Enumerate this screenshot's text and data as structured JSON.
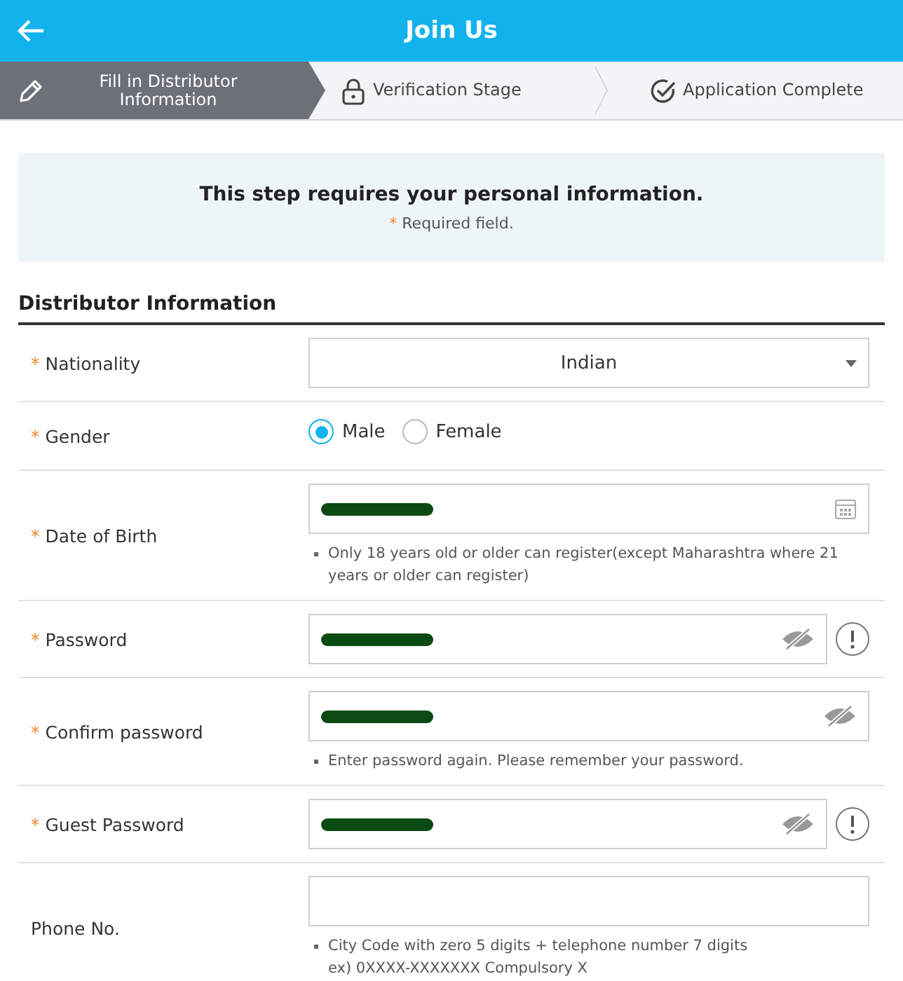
{
  "header": {
    "back_button": true,
    "title": "Join Us"
  },
  "steps": [
    {
      "label": "Fill in Distributor\nInformation",
      "selected": true
    },
    {
      "label": "Verification Stage",
      "selected": false
    },
    {
      "label": "Application Complete",
      "selected": false
    }
  ],
  "notice": {
    "title": "This step requires your personal information.",
    "required_mark": "*",
    "required_note": "Required field."
  },
  "section_title": "Distributor Information",
  "fields": [
    {
      "kind": "select",
      "required_mark": "*",
      "label": "Nationality",
      "value": "Indian"
    },
    {
      "kind": "radio",
      "required_mark": "*",
      "label": "Gender",
      "options": [
        {
          "label": "Male",
          "selected": true
        },
        {
          "label": "Female",
          "selected": false
        }
      ]
    },
    {
      "kind": "date",
      "required_mark": "*",
      "label": "Date of Birth",
      "redacted": true,
      "hint": "Only 18 years old or older can register(except Maharashtra where 21 years or older can register)"
    },
    {
      "kind": "password",
      "required_mark": "*",
      "label": "Password",
      "redacted": true,
      "info_button": true
    },
    {
      "kind": "password",
      "required_mark": "*",
      "label": "Confirm password",
      "redacted": true,
      "hint": "Enter password again. Please remember your password."
    },
    {
      "kind": "password",
      "required_mark": "*",
      "label": "Guest Password",
      "redacted": true,
      "info_button": true
    },
    {
      "kind": "text",
      "label": "Phone No.",
      "hint": "City Code with zero 5 digits + telephone number 7 digits\nex) 0XXXX-XXXXXXX Compulsory X"
    }
  ]
}
